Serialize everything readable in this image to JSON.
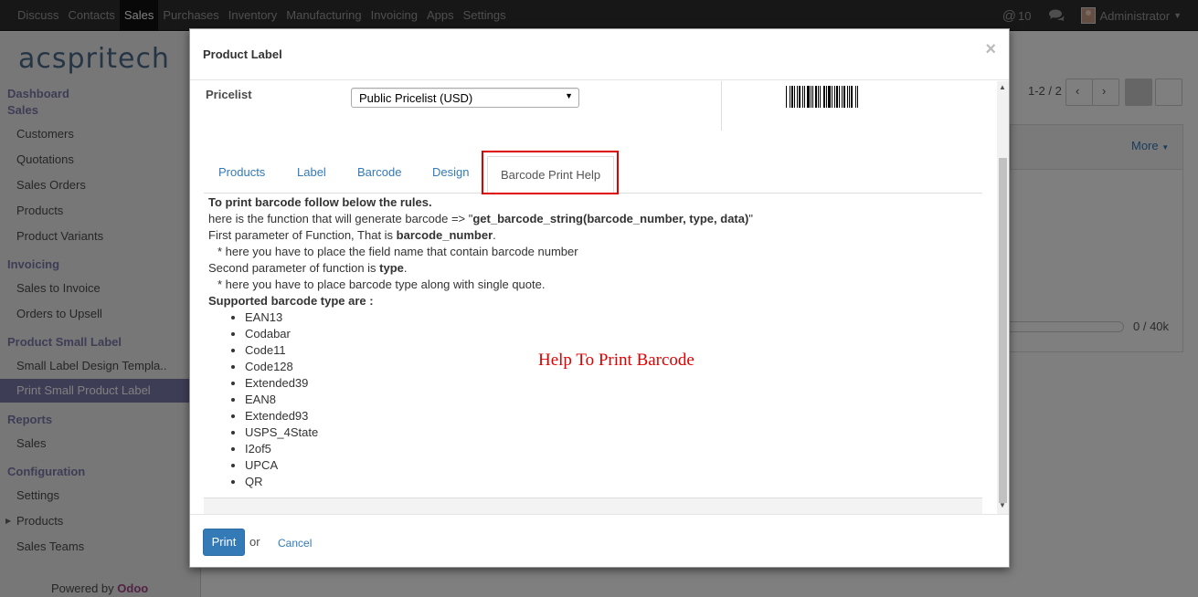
{
  "topbar": {
    "menu": [
      "Discuss",
      "Contacts",
      "Sales",
      "Purchases",
      "Inventory",
      "Manufacturing",
      "Invoicing",
      "Apps",
      "Settings"
    ],
    "active": "Sales",
    "mentions_count": "10",
    "user": "Administrator"
  },
  "sidebar": {
    "logo": "acspritech",
    "dashboard": "Dashboard",
    "sales_head": "Sales",
    "sales_items": [
      "Customers",
      "Quotations",
      "Sales Orders",
      "Products",
      "Product Variants"
    ],
    "invoicing_head": "Invoicing",
    "invoicing_items": [
      "Sales to Invoice",
      "Orders to Upsell"
    ],
    "psl_head": "Product Small Label",
    "psl_items": [
      "Small Label Design Templa..",
      "Print Small Product Label"
    ],
    "reports_head": "Reports",
    "reports_items": [
      "Sales"
    ],
    "config_head": "Configuration",
    "config_items": [
      "Settings",
      "Products",
      "Sales Teams"
    ],
    "powered_by": "Powered by",
    "powered_brand": "Odoo"
  },
  "background": {
    "pager": "1-2 / 2",
    "more": "More",
    "progress_count": "0 / 40k"
  },
  "modal": {
    "title": "Product Label",
    "close": "×",
    "pricelist_label": "Pricelist",
    "pricelist_value": "Public Pricelist (USD)",
    "tabs": [
      "Products",
      "Label",
      "Barcode",
      "Design",
      "Barcode Print Help"
    ],
    "help": {
      "line1": "To print barcode follow below the rules.",
      "line2_pre": "here is the function that will generate barcode => \"",
      "line2_code": "get_barcode_string(barcode_number, type, data)",
      "line2_post": "\"",
      "line3_pre": "First parameter of Function, That is ",
      "line3_bold": "barcode_number",
      "line3_post": ".",
      "line4": "* here you have to place the field name that contain barcode number",
      "line5_pre": "Second parameter of function is ",
      "line5_bold": "type",
      "line5_post": ".",
      "line6": "* here you have to place barcode type along with single quote.",
      "line7": "Supported barcode type are :",
      "types": [
        "EAN13",
        "Codabar",
        "Code11",
        "Code128",
        "Extended39",
        "EAN8",
        "Extended93",
        "USPS_4State",
        "I2of5",
        "UPCA",
        "QR"
      ]
    },
    "annotation": "Help To Print Barcode",
    "print_label": "Print",
    "or_text": "or",
    "cancel_label": "Cancel"
  }
}
